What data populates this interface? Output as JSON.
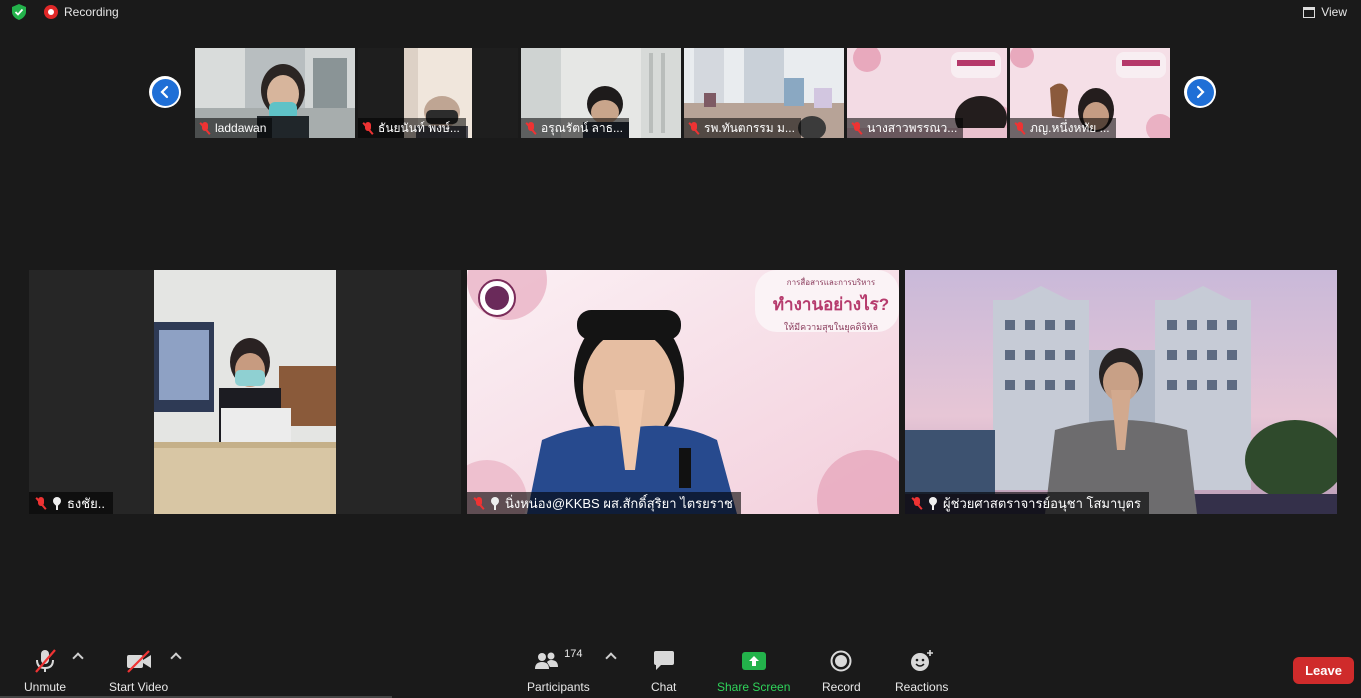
{
  "top_bar": {
    "recording_label": "Recording",
    "view_label": "View"
  },
  "thumbnails": [
    {
      "name": "laddawan"
    },
    {
      "name": "ธันยนันท์ พงษ์..."
    },
    {
      "name": "อรุณรัตน์  ลาธ..."
    },
    {
      "name": "รพ.ทันตกรรม ม..."
    },
    {
      "name": "นางสาวพรรณว..."
    },
    {
      "name": "ภญ.หนึ่งหทัย  ..."
    }
  ],
  "tiles": [
    {
      "name": "ธงชัย.."
    },
    {
      "name": "นิ่งหน่อง@KKBS ผส.สักดิ์สุริยา ไตรยราช"
    },
    {
      "name": "ผู้ช่วยศาสตราจารย์อนุชา โสมาบุตร"
    }
  ],
  "slide_text": {
    "small_title": "การสื่อสารและการบริหาร",
    "headline": "ทำงานอย่างไร?",
    "subline": "ให้มีความสุขในยุคดิจิทัล"
  },
  "toolbar": {
    "unmute": "Unmute",
    "start_video": "Start Video",
    "participants": "Participants",
    "participants_count": "174",
    "chat": "Chat",
    "share_screen": "Share Screen",
    "record": "Record",
    "reactions": "Reactions",
    "leave": "Leave"
  },
  "colors": {
    "background": "#1a1a1a",
    "share_green": "#23b24b",
    "leave_red": "#cf2b2b",
    "accent_blue": "#1f6fd6"
  }
}
